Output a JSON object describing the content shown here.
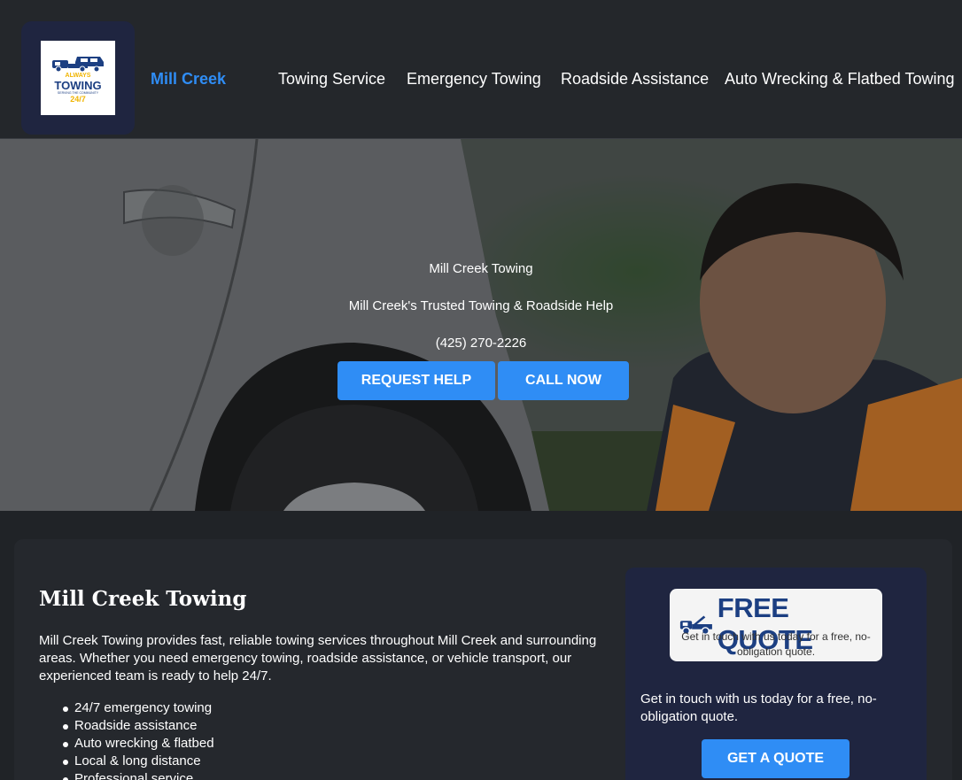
{
  "header": {
    "logo": {
      "line1": "ALWAYS",
      "line2": "TOWING",
      "line3": "SERVING THE COMMUNITY",
      "line4": "24/7"
    },
    "brand": "Mill Creek",
    "nav": [
      "Towing Service",
      "Emergency Towing",
      "Roadside Assistance",
      "Auto Wrecking & Flatbed Towing"
    ]
  },
  "hero": {
    "title": "Mill Creek Towing",
    "tagline": "Mill Creek's Trusted Towing & Roadside Help",
    "phone": "(425) 270-2226",
    "request_label": "REQUEST HELP",
    "call_label": "CALL NOW"
  },
  "about": {
    "heading": "Mill Creek Towing",
    "paragraph": "Mill Creek Towing provides fast, reliable towing services throughout Mill Creek and surrounding areas. Whether you need emergency towing, roadside assistance, or vehicle transport, our experienced team is ready to help 24/7.",
    "features": [
      "24/7 emergency towing",
      "Roadside assistance",
      "Auto wrecking & flatbed",
      "Local & long distance",
      "Professional service"
    ]
  },
  "quote": {
    "image_title": "FREE QUOTE",
    "image_sub": "Get in touch with us today for a free, no-obligation quote.",
    "text": "Get in touch with us today for a free, no-obligation quote.",
    "button_label": "GET A QUOTE"
  },
  "colors": {
    "accent": "#2f8df5",
    "header_bg": "#24272b",
    "panel_bg": "#1f2540"
  }
}
